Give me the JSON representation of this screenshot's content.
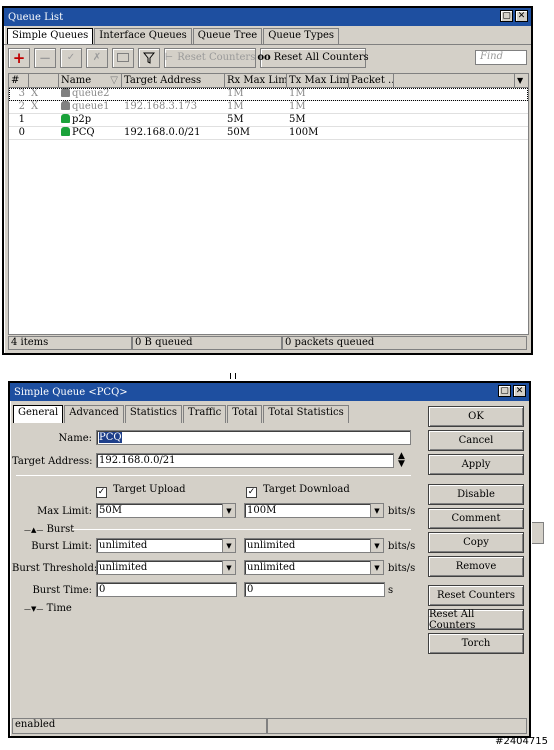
{
  "queue_list": {
    "title": "Queue List",
    "tabs": [
      "Simple Queues",
      "Interface Queues",
      "Queue Tree",
      "Queue Types"
    ],
    "toolbar": {
      "reset_counters": "Reset Counters",
      "reset_all_counters": "Reset All Counters",
      "find_placeholder": "Find"
    },
    "columns": [
      "#",
      "",
      "Name",
      "Target Address",
      "Rx Max Limit",
      "Tx Max Limit",
      "Packet ..."
    ],
    "rows": [
      {
        "num": "3",
        "flag": "X",
        "name": "queue2",
        "target": "",
        "rx": "1M",
        "tx": "1M"
      },
      {
        "num": "2",
        "flag": "X",
        "name": "queue1",
        "target": "192.168.3.173",
        "rx": "1M",
        "tx": "1M"
      },
      {
        "num": "1",
        "flag": "",
        "name": "p2p",
        "target": "",
        "rx": "5M",
        "tx": "5M"
      },
      {
        "num": "0",
        "flag": "",
        "name": "PCQ",
        "target": "192.168.0.0/21",
        "rx": "50M",
        "tx": "100M"
      }
    ],
    "status": {
      "items": "4 items",
      "queued": "0 B queued",
      "packets": "0 packets queued"
    }
  },
  "queue_dialog": {
    "title": "Simple Queue <PCQ>",
    "tabs": [
      "General",
      "Advanced",
      "Statistics",
      "Traffic",
      "Total",
      "Total Statistics"
    ],
    "labels": {
      "name": "Name:",
      "target_address": "Target Address:",
      "target_upload": "Target Upload",
      "target_download": "Target Download",
      "max_limit": "Max Limit:",
      "burst": "Burst",
      "burst_limit": "Burst Limit:",
      "burst_threshold": "Burst Threshold:",
      "burst_time": "Burst Time:",
      "time": "Time"
    },
    "values": {
      "name": "PCQ",
      "target_address": "192.168.0.0/21",
      "max_limit_up": "50M",
      "max_limit_down": "100M",
      "burst_limit_up": "unlimited",
      "burst_limit_down": "unlimited",
      "burst_threshold_up": "unlimited",
      "burst_threshold_down": "unlimited",
      "burst_time_up": "0",
      "burst_time_down": "0"
    },
    "units": {
      "bits": "bits/s",
      "seconds": "s"
    },
    "buttons": [
      "OK",
      "Cancel",
      "Apply",
      "Disable",
      "Comment",
      "Copy",
      "Remove",
      "Reset Counters",
      "Reset All Counters",
      "Torch"
    ],
    "status": "enabled"
  },
  "watermark": "#2404715"
}
